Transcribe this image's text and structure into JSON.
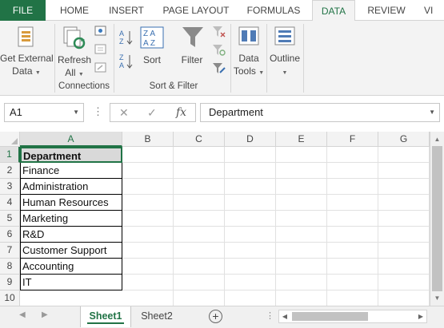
{
  "tabs": [
    {
      "label": "FILE"
    },
    {
      "label": "HOME"
    },
    {
      "label": "INSERT"
    },
    {
      "label": "PAGE LAYOUT"
    },
    {
      "label": "FORMULAS"
    },
    {
      "label": "DATA"
    },
    {
      "label": "REVIEW"
    },
    {
      "label": "VI"
    }
  ],
  "active_tab": "DATA",
  "ribbon": {
    "get_external_data": {
      "line1": "Get External",
      "line2": "Data"
    },
    "refresh_all": {
      "line1": "Refresh",
      "line2": "All"
    },
    "sort": {
      "label": "Sort"
    },
    "filter": {
      "label": "Filter"
    },
    "data_tools": {
      "line1": "Data",
      "line2": "Tools"
    },
    "outline": {
      "label": "Outline"
    },
    "groups": {
      "connections": "Connections",
      "sort_filter": "Sort & Filter"
    },
    "sort_az": {
      "top": "A",
      "bottom": "Z"
    },
    "sort_dialog": {
      "top": "Z A",
      "bottom": "A Z"
    }
  },
  "formula_bar": {
    "name_box": "A1",
    "dots": "⋮",
    "cancel": "✕",
    "enter": "✓",
    "fx": "fx",
    "content": "Department"
  },
  "grid": {
    "columns": [
      "A",
      "B",
      "C",
      "D",
      "E",
      "F",
      "G"
    ],
    "rows": [
      "1",
      "2",
      "3",
      "4",
      "5",
      "6",
      "7",
      "8",
      "9",
      "10"
    ],
    "cells": [
      "Department",
      "Finance",
      "Administration",
      "Human Resources",
      "Marketing",
      "R&D",
      "Customer Support",
      "Accounting",
      "IT",
      ""
    ]
  },
  "sheets": [
    "Sheet1",
    "Sheet2"
  ],
  "active_sheet": "Sheet1",
  "sheet_nav": {
    "prev": "◀",
    "next": "▶",
    "add": "+",
    "dots": "⋮"
  },
  "colors": {
    "accent": "#217346",
    "header_cell_fill": "#d9d9d9",
    "ribbon_bg": "#f3f3f3"
  }
}
